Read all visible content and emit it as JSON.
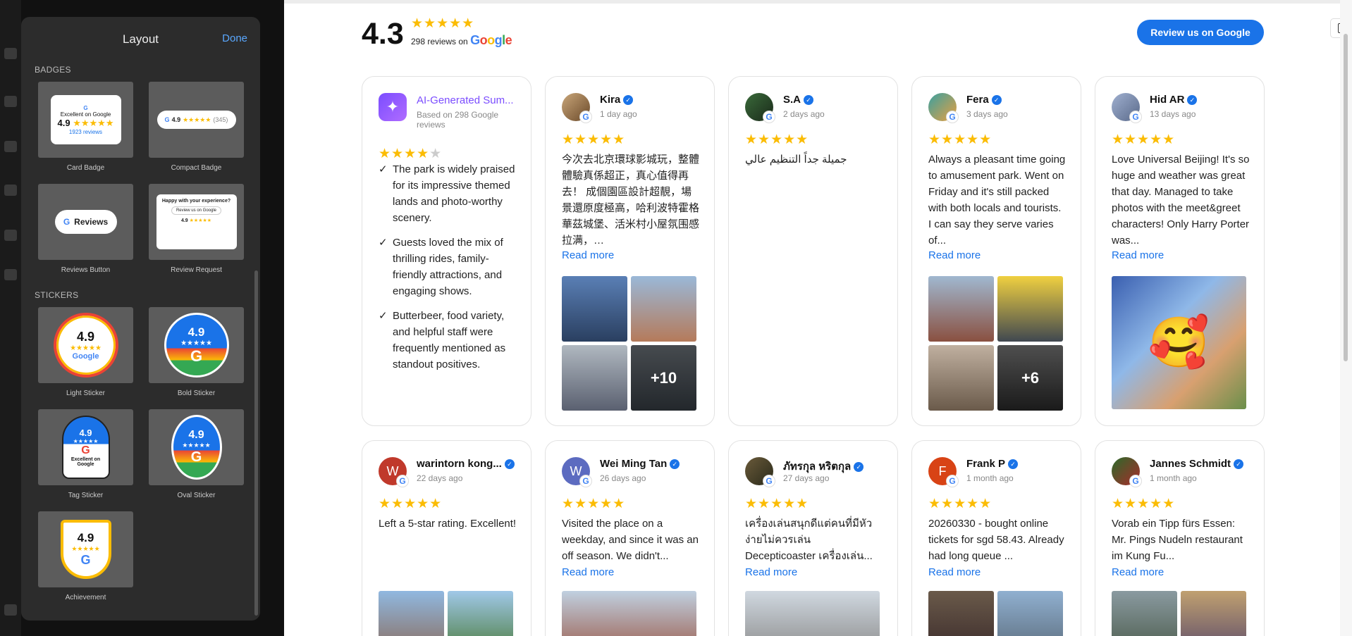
{
  "panel": {
    "title": "Layout",
    "done": "Done",
    "badges_heading": "BADGES",
    "stickers_heading": "STICKERS",
    "badges": [
      {
        "label": "Card Badge"
      },
      {
        "label": "Compact Badge"
      },
      {
        "label": "Reviews Button"
      },
      {
        "label": "Review Request"
      }
    ],
    "stickers": [
      {
        "label": "Light Sticker"
      },
      {
        "label": "Bold Sticker"
      },
      {
        "label": "Tag Sticker"
      },
      {
        "label": "Oval Sticker"
      },
      {
        "label": "Achievement"
      }
    ],
    "thumbs": {
      "card_text": "Excellent on Google",
      "card_rating": "4.9",
      "card_count": "1923 reviews",
      "compact_rating": "4.9",
      "compact_count": "(345)",
      "reviews_btn": "Reviews",
      "req_title": "Happy with your experience?",
      "req_btn": "Review us on Google",
      "req_rating": "4.9",
      "sticker_rating": "4.9",
      "sticker_google": "Google",
      "tag_text": "Excellent on Google"
    }
  },
  "header": {
    "rating": "4.3",
    "stars": "★★★★★",
    "review_count": "298 reviews on",
    "google_word": "Google",
    "review_button": "Review us on Google"
  },
  "ai_card": {
    "title": "AI-Generated Sum...",
    "subtitle": "Based on 298 Google reviews",
    "stars": "★★★★★",
    "rating_value": 4,
    "points": [
      "The park is widely praised for its impressive themed lands and photo-worthy scenery.",
      "Guests loved the mix of thrilling rides, family-friendly attractions, and engaging shows.",
      "Butterbeer, food variety, and helpful staff were frequently mentioned as standout positives."
    ]
  },
  "reviews": [
    {
      "name": "Kira",
      "date": "1 day ago",
      "stars": "★★★★★",
      "text": "今次去北京環球影城玩，整體體驗真係超正，真心值得再去！ 成個園區設計超靚，場景還原度極高，哈利波特霍格華茲城堡、活米村小屋氛围感拉满，…",
      "read_more": "Read more",
      "more_photos": "+10"
    },
    {
      "name": "S.A",
      "date": "2 days ago",
      "stars": "★★★★★",
      "text": "جميلة جداً التنظيم عالي"
    },
    {
      "name": "Fera",
      "date": "3 days ago",
      "stars": "★★★★★",
      "text": "Always a pleasant time going to amusement park. Went on Friday and it's still packed with both locals and tourists. I can say they serve varies of...",
      "read_more": "Read more",
      "more_photos": "+6"
    },
    {
      "name": "Hid AR",
      "date": "13 days ago",
      "stars": "★★★★★",
      "text": "Love Universal Beijing! It's so huge and weather was great that day. Managed to take photos with the meet&greet characters! Only Harry Porter was...",
      "read_more": "Read more"
    },
    {
      "name": "warintorn kong...",
      "date": "22 days ago",
      "stars": "★★★★★",
      "text": "Left a 5-star rating. Excellent!"
    },
    {
      "name": "Wei Ming Tan",
      "date": "26 days ago",
      "stars": "★★★★★",
      "text": "Visited the place on a weekday, and since it was an off season. We didn't...",
      "read_more": "Read more"
    },
    {
      "name": "ภัทรกุล หริตกุล",
      "date": "27 days ago",
      "stars": "★★★★★",
      "text": "เครื่องเล่นสนุกดีแต่คนที่มีหัวง่ายไม่ควรเล่น Decepticoaster เครื่องเล่น...",
      "read_more": "Read more"
    },
    {
      "name": "Frank P",
      "date": "1 month ago",
      "stars": "★★★★★",
      "text": "20260330 - bought online tickets for sgd 58.43. Already had long queue ...",
      "read_more": "Read more"
    },
    {
      "name": "Jannes Schmidt",
      "date": "1 month ago",
      "stars": "★★★★★",
      "text": "Vorab ein Tipp fürs Essen: Mr. Pings Nudeln restaurant im Kung Fu...",
      "read_more": "Read more"
    }
  ],
  "avatar_initials": {
    "warintorn": "W",
    "weiming": "W",
    "frank": "F"
  },
  "emoji": {
    "hid_photo": "🥰"
  },
  "colors": {
    "accent": "#1a73e8",
    "star": "#fbbc04",
    "ai": "#7b4dff"
  }
}
